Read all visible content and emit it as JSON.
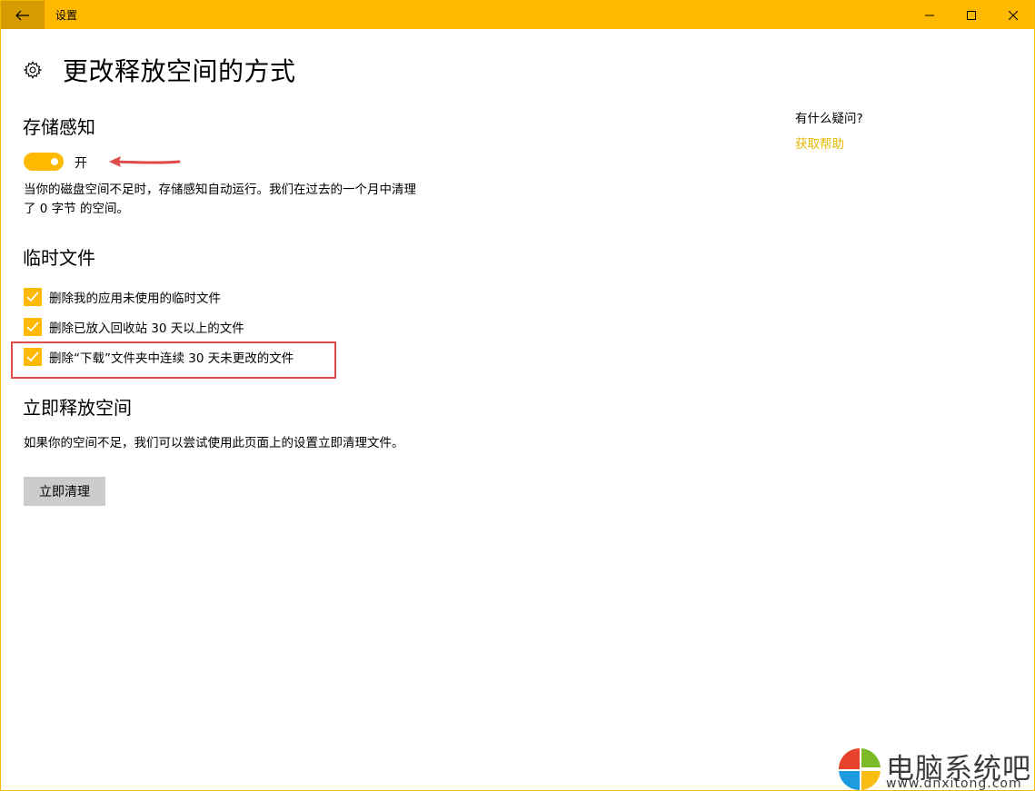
{
  "titlebar": {
    "title": "设置"
  },
  "page": {
    "title": "更改释放空间的方式"
  },
  "storage_sense": {
    "heading": "存储感知",
    "toggle_label": "开",
    "toggle_on": true,
    "description": "当你的磁盘空间不足时，存储感知自动运行。我们在过去的一个月中清理了 0 字节 的空间。"
  },
  "temp_files": {
    "heading": "临时文件",
    "items": [
      {
        "label": "删除我的应用未使用的临时文件",
        "checked": true
      },
      {
        "label": "删除已放入回收站 30 天以上的文件",
        "checked": true
      },
      {
        "label": "删除“下载”文件夹中连续 30 天未更改的文件",
        "checked": true
      }
    ]
  },
  "free_now": {
    "heading": "立即释放空间",
    "description": "如果你的空间不足，我们可以尝试使用此页面上的设置立即清理文件。",
    "button_label": "立即清理"
  },
  "help": {
    "question": "有什么疑问?",
    "link": "获取帮助"
  },
  "watermark": {
    "text": "电脑系统吧",
    "url": "www.dnxitong.com"
  },
  "colors": {
    "accent": "#ffb900",
    "back_button": "#d69b00",
    "highlight": "#e04a4a",
    "link": "#e8b800"
  },
  "icons": {
    "back": "back-arrow-icon",
    "minimize": "minimize-icon",
    "maximize": "maximize-icon",
    "close": "close-icon",
    "settings": "gear-icon",
    "check": "checkmark-icon",
    "annotation": "red-arrow-icon",
    "logo": "windows-logo-icon"
  }
}
